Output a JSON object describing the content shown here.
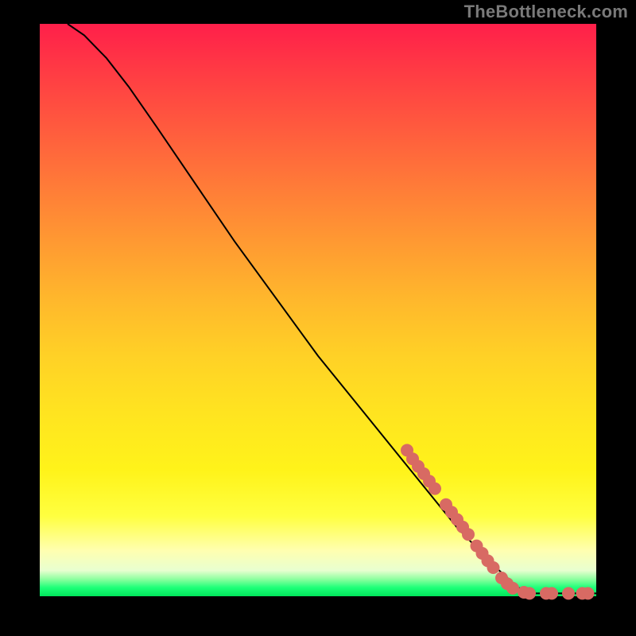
{
  "attribution": "TheBottleneck.com",
  "chart_data": {
    "type": "line",
    "title": "",
    "xlabel": "",
    "ylabel": "",
    "xlim": [
      0,
      100
    ],
    "ylim": [
      0,
      100
    ],
    "grid": false,
    "legend": false,
    "series": [
      {
        "name": "curve",
        "style": "line",
        "color": "#000000",
        "points": [
          {
            "x": 5,
            "y": 100
          },
          {
            "x": 8,
            "y": 98
          },
          {
            "x": 12,
            "y": 94
          },
          {
            "x": 16,
            "y": 89
          },
          {
            "x": 21,
            "y": 82
          },
          {
            "x": 35,
            "y": 62
          },
          {
            "x": 50,
            "y": 42
          },
          {
            "x": 65,
            "y": 24
          },
          {
            "x": 75,
            "y": 12
          },
          {
            "x": 82,
            "y": 5
          },
          {
            "x": 86,
            "y": 1.5
          },
          {
            "x": 88,
            "y": 0.5
          },
          {
            "x": 100,
            "y": 0.5
          }
        ]
      },
      {
        "name": "highlighted-points",
        "style": "scatter",
        "color": "#d86a63",
        "radius": 8,
        "points": [
          {
            "x": 66,
            "y": 25.5
          },
          {
            "x": 67,
            "y": 24.0
          },
          {
            "x": 68,
            "y": 22.7
          },
          {
            "x": 69,
            "y": 21.4
          },
          {
            "x": 70,
            "y": 20.1
          },
          {
            "x": 71,
            "y": 18.8
          },
          {
            "x": 73,
            "y": 16.0
          },
          {
            "x": 74,
            "y": 14.7
          },
          {
            "x": 75,
            "y": 13.4
          },
          {
            "x": 76,
            "y": 12.1
          },
          {
            "x": 77,
            "y": 10.8
          },
          {
            "x": 78.5,
            "y": 8.8
          },
          {
            "x": 79.5,
            "y": 7.5
          },
          {
            "x": 80.5,
            "y": 6.2
          },
          {
            "x": 81.5,
            "y": 5.0
          },
          {
            "x": 83,
            "y": 3.2
          },
          {
            "x": 84,
            "y": 2.2
          },
          {
            "x": 85,
            "y": 1.4
          },
          {
            "x": 87,
            "y": 0.7
          },
          {
            "x": 88,
            "y": 0.5
          },
          {
            "x": 91,
            "y": 0.5
          },
          {
            "x": 92,
            "y": 0.5
          },
          {
            "x": 95,
            "y": 0.5
          },
          {
            "x": 97.5,
            "y": 0.5
          },
          {
            "x": 98.5,
            "y": 0.5
          }
        ]
      }
    ]
  }
}
